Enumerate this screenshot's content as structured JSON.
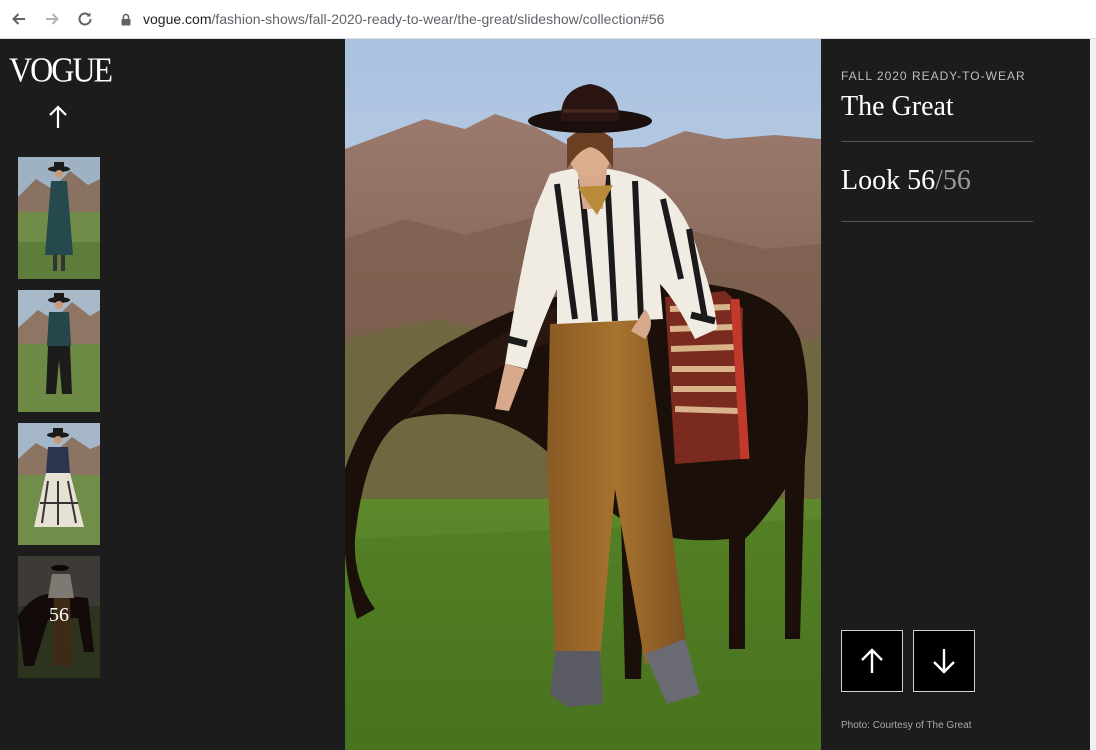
{
  "browser": {
    "url_host": "vogue.com",
    "url_path": "/fashion-shows/fall-2020-ready-to-wear/the-great/slideshow/collection#56",
    "icons": [
      "back-arrow-icon",
      "forward-arrow-icon",
      "reload-icon",
      "lock-icon"
    ]
  },
  "sidebar": {
    "logo": "VOGUE",
    "scroll_up_icon": "arrow-up-icon",
    "thumbnails": [
      {
        "label": ""
      },
      {
        "label": ""
      },
      {
        "label": ""
      },
      {
        "label": "56",
        "active": true
      }
    ]
  },
  "details": {
    "season": "FALL 2020 READY-TO-WEAR",
    "designer": "The Great",
    "look_prefix": "Look 56",
    "look_total": "/56",
    "prev_icon": "arrow-up-icon",
    "next_icon": "arrow-down-icon",
    "credit": "Photo: Courtesy of The Great"
  },
  "colors": {
    "page_background": "#1c1c1c",
    "text_primary": "#ffffff",
    "text_muted": "#9a9a9a"
  }
}
